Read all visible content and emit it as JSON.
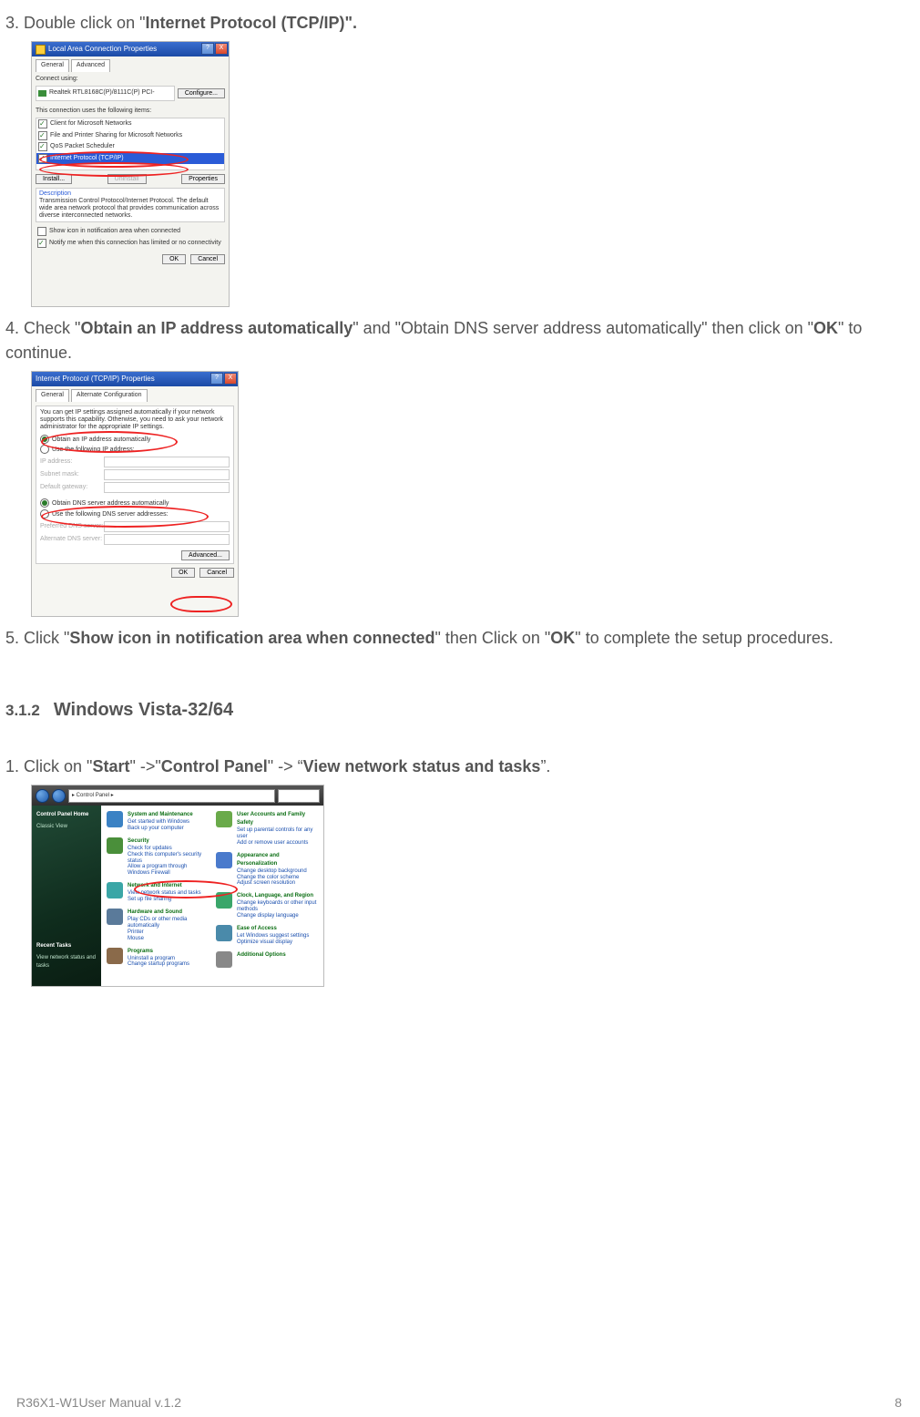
{
  "steps": {
    "s3_pre": "3. Double click on \"",
    "s3_bold": "Internet Protocol (TCP/IP)\".",
    "s4_pre": "4. Check \"",
    "s4_b1": "Obtain an IP address automatically",
    "s4_mid": "\" and \"Obtain DNS server address automatically\" then click on \"",
    "s4_b2": "OK",
    "s4_post": "\" to continue.",
    "s5_pre": "5. Click \"",
    "s5_b1": "Show icon in notification area when connected",
    "s5_mid": "\" then Click on \"",
    "s5_b2": "OK",
    "s5_post": "\" to complete the setup procedures."
  },
  "section": {
    "num": "3.1.2",
    "title": "Windows Vista-32/64"
  },
  "vista_step": {
    "pre": "1. Click on \"",
    "b1": "Start",
    "m1": "\" ->\"",
    "b2": "Control Panel",
    "m2": "\" -> “",
    "b3": "View network status and tasks",
    "post": "”."
  },
  "dlg1": {
    "title": "Local Area Connection Properties",
    "tab_general": "General",
    "tab_advanced": "Advanced",
    "connect_using": "Connect using:",
    "adapter": "Realtek RTL8168C(P)/8111C(P) PCI-",
    "configure": "Configure...",
    "items_label": "This connection uses the following items:",
    "item1": "Client for Microsoft Networks",
    "item2": "File and Printer Sharing for Microsoft Networks",
    "item3": "QoS Packet Scheduler",
    "item4": "Internet Protocol (TCP/IP)",
    "install": "Install...",
    "uninstall": "Uninstall",
    "properties": "Properties",
    "desc_h": "Description",
    "desc": "Transmission Control Protocol/Internet Protocol. The default wide area network protocol that provides communication across diverse interconnected networks.",
    "show_icon": "Show icon in notification area when connected",
    "notify": "Notify me when this connection has limited or no connectivity",
    "ok": "OK",
    "cancel": "Cancel"
  },
  "dlg2": {
    "title": "Internet Protocol (TCP/IP) Properties",
    "tab_general": "General",
    "tab_alt": "Alternate Configuration",
    "blurb": "You can get IP settings assigned automatically if your network supports this capability. Otherwise, you need to ask your network administrator for the appropriate IP settings.",
    "r1": "Obtain an IP address automatically",
    "r2": "Use the following IP address:",
    "ip": "IP address:",
    "subnet": "Subnet mask:",
    "gw": "Default gateway:",
    "r3": "Obtain DNS server address automatically",
    "r4": "Use the following DNS server addresses:",
    "pdns": "Preferred DNS server:",
    "adns": "Alternate DNS server:",
    "advanced": "Advanced...",
    "ok": "OK",
    "cancel": "Cancel"
  },
  "dlg3": {
    "loc": "▸ Control Panel ▸",
    "side_h": "Control Panel Home",
    "side_1": "Classic View",
    "side_rt": "Recent Tasks",
    "side_rt1": "View network status and tasks",
    "c1_t": "System and Maintenance",
    "c1_s": "Get started with Windows\nBack up your computer",
    "c2_t": "Security",
    "c2_s": "Check for updates\nCheck this computer's security status\nAllow a program through Windows Firewall",
    "c3_t": "Network and Internet",
    "c3_s": "View network status and tasks\nSet up file sharing",
    "c4_t": "Hardware and Sound",
    "c4_s": "Play CDs or other media automatically\nPrinter\nMouse",
    "c5_t": "Programs",
    "c5_s": "Uninstall a program\nChange startup programs",
    "c6_t": "User Accounts and Family Safety",
    "c6_s": "Set up parental controls for any user\nAdd or remove user accounts",
    "c7_t": "Appearance and Personalization",
    "c7_s": "Change desktop background\nChange the color scheme\nAdjust screen resolution",
    "c8_t": "Clock, Language, and Region",
    "c8_s": "Change keyboards or other input methods\nChange display language",
    "c9_t": "Ease of Access",
    "c9_s": "Let Windows suggest settings\nOptimize visual display",
    "c10_t": "Additional Options"
  },
  "footer": {
    "left": "R36X1-W1User Manual v.1.2",
    "right": "8"
  }
}
